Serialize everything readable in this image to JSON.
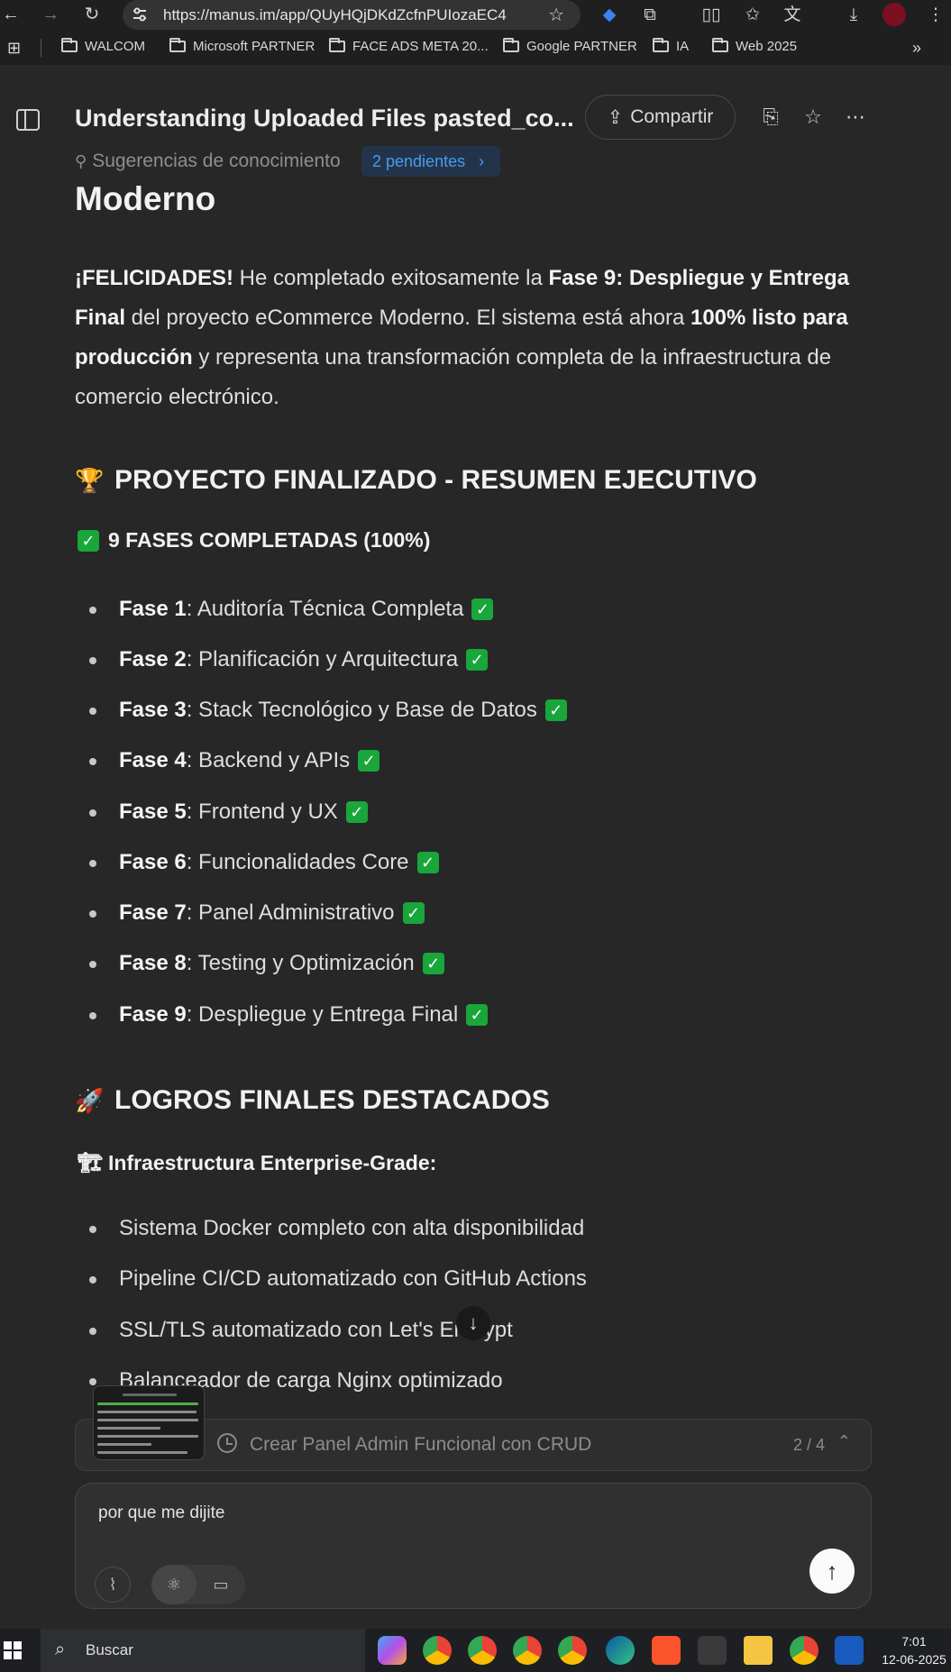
{
  "browser": {
    "url": "https://manus.im/app/QUyHQjDKdZcfnPUIozaEC4",
    "bookmarks": [
      "WALCOM",
      "Microsoft PARTNER",
      "FACE ADS META 20...",
      "Google PARTNER",
      "IA",
      "Web 2025"
    ],
    "more_bookmarks": "»"
  },
  "header": {
    "title": "Understanding Uploaded Files pasted_co...",
    "share_label": "Compartir",
    "suggestions_label": "Sugerencias de conocimiento",
    "pending_label": "2 pendientes"
  },
  "content": {
    "heading_tail": "Moderno",
    "intro": {
      "p1_bold": "¡FELICIDADES!",
      "p1": " He completado exitosamente la ",
      "p2_bold": "Fase 9: Despliegue y Entrega Final",
      "p2": " del proyecto eCommerce Moderno. El sistema está ahora ",
      "p3_bold": "100% listo para producción",
      "p3": " y representa una transformación completa de la infraestructura de comercio electrónico."
    },
    "section1_title": "PROYECTO FINALIZADO - RESUMEN EJECUTIVO",
    "section1_sub": "9 FASES COMPLETADAS (100%)",
    "phases": [
      {
        "label": "Fase 1",
        "text": ": Auditoría Técnica Completa"
      },
      {
        "label": "Fase 2",
        "text": ": Planificación y Arquitectura"
      },
      {
        "label": "Fase 3",
        "text": ": Stack Tecnológico y Base de Datos"
      },
      {
        "label": "Fase 4",
        "text": ": Backend y APIs"
      },
      {
        "label": "Fase 5",
        "text": ": Frontend y UX"
      },
      {
        "label": "Fase 6",
        "text": ": Funcionalidades Core"
      },
      {
        "label": "Fase 7",
        "text": ": Panel Administrativo"
      },
      {
        "label": "Fase 8",
        "text": ": Testing y Optimización"
      },
      {
        "label": "Fase 9",
        "text": ": Despliegue y Entrega Final"
      }
    ],
    "section2_title": "LOGROS FINALES DESTACADOS",
    "section2_sub": "Infraestructura Enterprise-Grade:",
    "achievements": [
      "Sistema Docker completo con alta disponibilidad",
      "Pipeline CI/CD automatizado con GitHub Actions",
      "SSL/TLS automatizado con Let's Encrypt",
      "Balanceador de carga Nginx optimizado"
    ]
  },
  "task": {
    "text": "Crear Panel Admin Funcional con CRUD",
    "progress": "2 / 4"
  },
  "input": {
    "value": "por que me dijite"
  },
  "taskbar": {
    "search_label": "Buscar",
    "time": "7:01",
    "date": "12-06-2025"
  },
  "icons": {
    "check": "✓",
    "trophy": "🏆",
    "rocket": "🚀",
    "crane": "🏗"
  },
  "colors": {
    "background": "#272727",
    "pending_bg": "#23344a",
    "pending_text": "#4a9af0",
    "check_green": "#19a63b"
  }
}
